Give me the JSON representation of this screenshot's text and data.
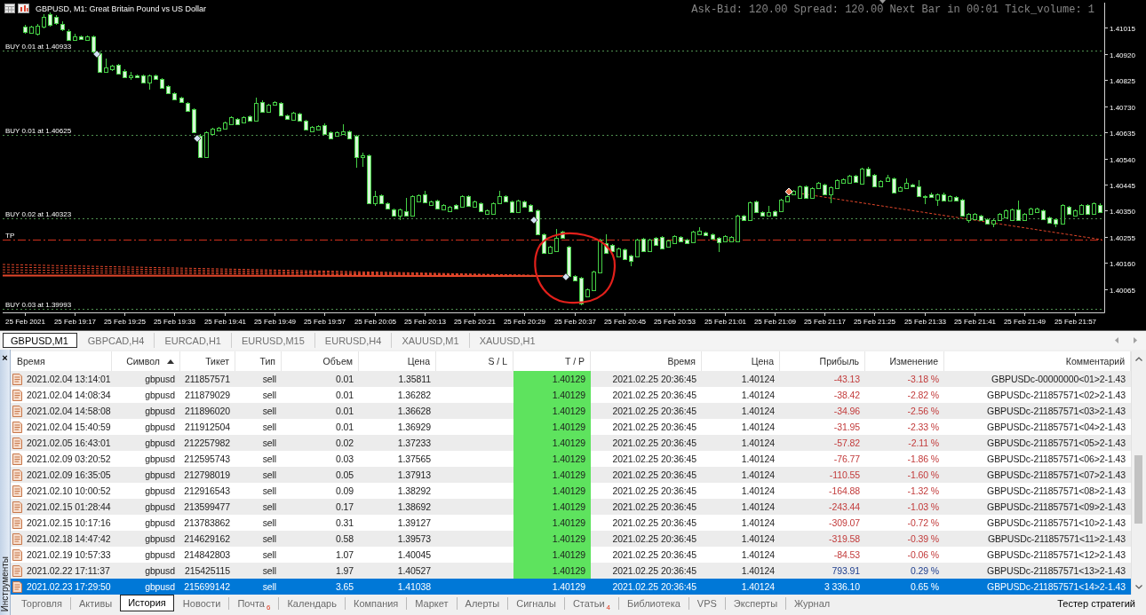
{
  "chart_window": {
    "title": "GBPUSD, M1: Great Britain Pound vs US Dollar",
    "info": "Ask-Bid: 120.00 Spread: 120.00 Next Bar in 00:01 Tick_volume: 1",
    "chart_data": [
      {
        "type": "candlestick",
        "ylim": [
          1.3998,
          1.41107
        ],
        "xlim": [
          "2021-02-25T19:05:30",
          "2021-02-25T22:01:45"
        ],
        "yticks": [
          1.40065,
          {
            "value": 1.4016,
            "label": "1.40160"
          },
          1.40255,
          {
            "value": 1.4035,
            "label": "1.40350"
          },
          1.40445,
          {
            "value": 1.4054,
            "label": "1.40540"
          },
          1.40635,
          {
            "value": 1.4073,
            "label": "1.40730"
          },
          1.40825,
          {
            "value": 1.4092,
            "label": "1.40920"
          },
          1.41015
        ],
        "xticks": [
          {
            "value": "2021-02-25T19:09",
            "label": "25 Feb 2021"
          },
          {
            "value": "2021-02-25T19:17",
            "label": "25 Feb 19:17"
          },
          {
            "value": "2021-02-25T19:25",
            "label": "25 Feb 19:25"
          },
          {
            "value": "2021-02-25T19:33",
            "label": "25 Feb 19:33"
          },
          {
            "value": "2021-02-25T19:41",
            "label": "25 Feb 19:41"
          },
          {
            "value": "2021-02-25T19:49",
            "label": "25 Feb 19:49"
          },
          {
            "value": "2021-02-25T19:57",
            "label": "25 Feb 19:57"
          },
          {
            "value": "2021-02-25T20:05",
            "label": "25 Feb 20:05"
          },
          {
            "value": "2021-02-25T20:13",
            "label": "25 Feb 20:13"
          },
          {
            "value": "2021-02-25T20:21",
            "label": "25 Feb 20:21"
          },
          {
            "value": "2021-02-25T20:29",
            "label": "25 Feb 20:29"
          },
          {
            "value": "2021-02-25T20:37",
            "label": "25 Feb 20:37"
          },
          {
            "value": "2021-02-25T20:45",
            "label": "25 Feb 20:45"
          },
          {
            "value": "2021-02-25T20:53",
            "label": "25 Feb 20:53"
          },
          {
            "value": "2021-02-25T21:01",
            "label": "25 Feb 21:01"
          },
          {
            "value": "2021-02-25T21:09",
            "label": "25 Feb 21:09"
          },
          {
            "value": "2021-02-25T21:17",
            "label": "25 Feb 21:17"
          },
          {
            "value": "2021-02-25T21:25",
            "label": "25 Feb 21:25"
          },
          {
            "value": "2021-02-25T21:33",
            "label": "25 Feb 21:33"
          },
          {
            "value": "2021-02-25T21:41",
            "label": "25 Feb 21:41"
          },
          {
            "value": "2021-02-25T21:49",
            "label": "25 Feb 21:49"
          },
          {
            "value": "2021-02-25T21:57",
            "label": "25 Feb 21:57"
          }
        ],
        "ref_lines": [
          {
            "axis": "y",
            "value": 1.40933,
            "label": "BUY 0.01 at 1.40933",
            "color": "#4f8f4f",
            "line_style": "dotted"
          },
          {
            "axis": "y",
            "value": 1.40625,
            "label": "BUY 0.01 at 1.40625",
            "color": "#4f8f4f",
            "line_style": "dotted"
          },
          {
            "axis": "y",
            "value": 1.40323,
            "label": "BUY 0.02 at 1.40323",
            "color": "#4f8f4f",
            "line_style": "dotted"
          },
          {
            "axis": "y",
            "value": 1.40245,
            "label": "TP",
            "color": "#d0301c",
            "line_style": "dashdot"
          },
          {
            "axis": "y",
            "value": 1.39993,
            "label": "BUY 0.03 at 1.39993",
            "color": "#4f8f4f",
            "line_style": "dotted"
          }
        ],
        "x": [
          "2021-02-25T19:09",
          "2021-02-25T19:10",
          "2021-02-25T19:11",
          "2021-02-25T19:12",
          "2021-02-25T19:13",
          "2021-02-25T19:14",
          "2021-02-25T19:15",
          "2021-02-25T19:16",
          "2021-02-25T19:17",
          "2021-02-25T19:18",
          "2021-02-25T19:19",
          "2021-02-25T19:20",
          "2021-02-25T19:21",
          "2021-02-25T19:22",
          "2021-02-25T19:23",
          "2021-02-25T19:24",
          "2021-02-25T19:25",
          "2021-02-25T19:26",
          "2021-02-25T19:27",
          "2021-02-25T19:28",
          "2021-02-25T19:29",
          "2021-02-25T19:30",
          "2021-02-25T19:31",
          "2021-02-25T19:32",
          "2021-02-25T19:33",
          "2021-02-25T19:34",
          "2021-02-25T19:35",
          "2021-02-25T19:36",
          "2021-02-25T19:37",
          "2021-02-25T19:38",
          "2021-02-25T19:39",
          "2021-02-25T19:40",
          "2021-02-25T19:41",
          "2021-02-25T19:42",
          "2021-02-25T19:43",
          "2021-02-25T19:44",
          "2021-02-25T19:45",
          "2021-02-25T19:46",
          "2021-02-25T19:47",
          "2021-02-25T19:48",
          "2021-02-25T19:49",
          "2021-02-25T19:50",
          "2021-02-25T19:51",
          "2021-02-25T19:52",
          "2021-02-25T19:53",
          "2021-02-25T19:54",
          "2021-02-25T19:55",
          "2021-02-25T19:56",
          "2021-02-25T19:57",
          "2021-02-25T19:58",
          "2021-02-25T19:59",
          "2021-02-25T20:00",
          "2021-02-25T20:01",
          "2021-02-25T20:02",
          "2021-02-25T20:03",
          "2021-02-25T20:04",
          "2021-02-25T20:05",
          "2021-02-25T20:06",
          "2021-02-25T20:07",
          "2021-02-25T20:08",
          "2021-02-25T20:09",
          "2021-02-25T20:10",
          "2021-02-25T20:11",
          "2021-02-25T20:12",
          "2021-02-25T20:13",
          "2021-02-25T20:14",
          "2021-02-25T20:15",
          "2021-02-25T20:16",
          "2021-02-25T20:17",
          "2021-02-25T20:18",
          "2021-02-25T20:19",
          "2021-02-25T20:20",
          "2021-02-25T20:21",
          "2021-02-25T20:22",
          "2021-02-25T20:23",
          "2021-02-25T20:24",
          "2021-02-25T20:25",
          "2021-02-25T20:26",
          "2021-02-25T20:27",
          "2021-02-25T20:28",
          "2021-02-25T20:29",
          "2021-02-25T20:30",
          "2021-02-25T20:31",
          "2021-02-25T20:32",
          "2021-02-25T20:33",
          "2021-02-25T20:34",
          "2021-02-25T20:35",
          "2021-02-25T20:36",
          "2021-02-25T20:37",
          "2021-02-25T20:38",
          "2021-02-25T20:39",
          "2021-02-25T20:40",
          "2021-02-25T20:41",
          "2021-02-25T20:42",
          "2021-02-25T20:43",
          "2021-02-25T20:44",
          "2021-02-25T20:45",
          "2021-02-25T20:46",
          "2021-02-25T20:47",
          "2021-02-25T20:48",
          "2021-02-25T20:49",
          "2021-02-25T20:50",
          "2021-02-25T20:51",
          "2021-02-25T20:52",
          "2021-02-25T20:53",
          "2021-02-25T20:54",
          "2021-02-25T20:55",
          "2021-02-25T20:56",
          "2021-02-25T20:57",
          "2021-02-25T20:58",
          "2021-02-25T20:59",
          "2021-02-25T21:00",
          "2021-02-25T21:01",
          "2021-02-25T21:02",
          "2021-02-25T21:03",
          "2021-02-25T21:04",
          "2021-02-25T21:05",
          "2021-02-25T21:06",
          "2021-02-25T21:07",
          "2021-02-25T21:08",
          "2021-02-25T21:09",
          "2021-02-25T21:10",
          "2021-02-25T21:11",
          "2021-02-25T21:12",
          "2021-02-25T21:13",
          "2021-02-25T21:14",
          "2021-02-25T21:15",
          "2021-02-25T21:16",
          "2021-02-25T21:17",
          "2021-02-25T21:18",
          "2021-02-25T21:19",
          "2021-02-25T21:20",
          "2021-02-25T21:21",
          "2021-02-25T21:22",
          "2021-02-25T21:23",
          "2021-02-25T21:24",
          "2021-02-25T21:25",
          "2021-02-25T21:26",
          "2021-02-25T21:27",
          "2021-02-25T21:28",
          "2021-02-25T21:29",
          "2021-02-25T21:30",
          "2021-02-25T21:31",
          "2021-02-25T21:32",
          "2021-02-25T21:33",
          "2021-02-25T21:34",
          "2021-02-25T21:35",
          "2021-02-25T21:36",
          "2021-02-25T21:37",
          "2021-02-25T21:38",
          "2021-02-25T21:39",
          "2021-02-25T21:40",
          "2021-02-25T21:41",
          "2021-02-25T21:42",
          "2021-02-25T21:43",
          "2021-02-25T21:44",
          "2021-02-25T21:45",
          "2021-02-25T21:46",
          "2021-02-25T21:47",
          "2021-02-25T21:48",
          "2021-02-25T21:49",
          "2021-02-25T21:50",
          "2021-02-25T21:51",
          "2021-02-25T21:52",
          "2021-02-25T21:53",
          "2021-02-25T21:54",
          "2021-02-25T21:55",
          "2021-02-25T21:56",
          "2021-02-25T21:57",
          "2021-02-25T21:58",
          "2021-02-25T21:59",
          "2021-02-25T22:00",
          "2021-02-25T22:01"
        ],
        "ohlc": [
          [
            1.4102,
            1.41027,
            1.40994,
            1.41001
          ],
          [
            1.40997,
            1.41023,
            1.40994,
            1.4102
          ],
          [
            1.40994,
            1.4103,
            1.40988,
            1.41023
          ],
          [
            1.4102,
            1.41065,
            1.41014,
            1.41056
          ],
          [
            1.41065,
            1.41072,
            1.4102,
            1.41027
          ],
          [
            1.41056,
            1.41062,
            1.41027,
            1.41033
          ],
          [
            1.4103,
            1.41039,
            1.41004,
            1.4101
          ],
          [
            1.41004,
            1.4101,
            1.40968,
            1.40972
          ],
          [
            1.40972,
            1.40994,
            1.40968,
            1.40985
          ],
          [
            1.40985,
            1.40988,
            1.40972,
            1.40975
          ],
          [
            1.40972,
            1.40988,
            1.40968,
            1.40985
          ],
          [
            1.40985,
            1.40988,
            1.40923,
            1.4093
          ],
          [
            1.40923,
            1.4093,
            1.40852,
            1.40855
          ],
          [
            1.40855,
            1.40904,
            1.40852,
            1.40872
          ],
          [
            1.40865,
            1.40881,
            1.40859,
            1.40878
          ],
          [
            1.40881,
            1.40884,
            1.40846,
            1.40849
          ],
          [
            1.40859,
            1.40865,
            1.40833,
            1.40836
          ],
          [
            1.40836,
            1.40855,
            1.40826,
            1.40842
          ],
          [
            1.40842,
            1.40846,
            1.40833,
            1.40836
          ],
          [
            1.40842,
            1.40846,
            1.40814,
            1.40817
          ],
          [
            1.40817,
            1.40846,
            1.40791,
            1.40842
          ],
          [
            1.40842,
            1.40846,
            1.40826,
            1.4083
          ],
          [
            1.4083,
            1.40833,
            1.40794,
            1.40797
          ],
          [
            1.40804,
            1.40807,
            1.40775,
            1.40778
          ],
          [
            1.40778,
            1.40781,
            1.40752,
            1.40755
          ],
          [
            1.40762,
            1.40765,
            1.40742,
            1.40746
          ],
          [
            1.40742,
            1.40746,
            1.4071,
            1.40713
          ],
          [
            1.4072,
            1.40723,
            1.40632,
            1.40636
          ],
          [
            1.40623,
            1.40629,
            1.40542,
            1.40545
          ],
          [
            1.40545,
            1.40639,
            1.40542,
            1.40636
          ],
          [
            1.40629,
            1.40652,
            1.40626,
            1.40649
          ],
          [
            1.40642,
            1.40655,
            1.40639,
            1.40652
          ],
          [
            1.40649,
            1.40674,
            1.40645,
            1.40671
          ],
          [
            1.40665,
            1.40694,
            1.40662,
            1.40691
          ],
          [
            1.40684,
            1.40688,
            1.40662,
            1.40665
          ],
          [
            1.40671,
            1.40694,
            1.40668,
            1.40691
          ],
          [
            1.40694,
            1.40697,
            1.40674,
            1.40678
          ],
          [
            1.40678,
            1.40762,
            1.40674,
            1.40742
          ],
          [
            1.40746,
            1.40752,
            1.40707,
            1.4071
          ],
          [
            1.4071,
            1.40739,
            1.40707,
            1.40736
          ],
          [
            1.40736,
            1.40749,
            1.40733,
            1.40746
          ],
          [
            1.40742,
            1.40746,
            1.40694,
            1.40697
          ],
          [
            1.40697,
            1.407,
            1.40681,
            1.40684
          ],
          [
            1.40681,
            1.4071,
            1.40678,
            1.40707
          ],
          [
            1.40704,
            1.40707,
            1.40674,
            1.40678
          ],
          [
            1.40678,
            1.40681,
            1.40642,
            1.40645
          ],
          [
            1.40639,
            1.40658,
            1.40636,
            1.40655
          ],
          [
            1.40645,
            1.40662,
            1.40642,
            1.40658
          ],
          [
            1.40662,
            1.40668,
            1.40626,
            1.40629
          ],
          [
            1.40636,
            1.40639,
            1.4061,
            1.40613
          ],
          [
            1.40623,
            1.40639,
            1.4062,
            1.40636
          ],
          [
            1.40629,
            1.40665,
            1.40626,
            1.40639
          ],
          [
            1.40639,
            1.40642,
            1.4061,
            1.40613
          ],
          [
            1.40623,
            1.40626,
            1.40507,
            1.40545
          ],
          [
            1.40545,
            1.40561,
            1.4051,
            1.40552
          ],
          [
            1.40552,
            1.40555,
            1.40374,
            1.40377
          ],
          [
            1.40377,
            1.40423,
            1.40368,
            1.40404
          ],
          [
            1.40407,
            1.4041,
            1.40374,
            1.40377
          ],
          [
            1.40377,
            1.40381,
            1.40354,
            1.40358
          ],
          [
            1.40354,
            1.40358,
            1.40329,
            1.40332
          ],
          [
            1.40332,
            1.40358,
            1.40316,
            1.40354
          ],
          [
            1.40348,
            1.40397,
            1.40329,
            1.40332
          ],
          [
            1.40332,
            1.40407,
            1.40329,
            1.40404
          ],
          [
            1.40384,
            1.4041,
            1.40381,
            1.40407
          ],
          [
            1.4041,
            1.40423,
            1.40377,
            1.40381
          ],
          [
            1.40371,
            1.40387,
            1.40368,
            1.40384
          ],
          [
            1.40387,
            1.4039,
            1.40354,
            1.40358
          ],
          [
            1.40354,
            1.40374,
            1.40351,
            1.40371
          ],
          [
            1.40348,
            1.40368,
            1.40345,
            1.40364
          ],
          [
            1.40371,
            1.40374,
            1.40354,
            1.40358
          ],
          [
            1.40364,
            1.40407,
            1.40361,
            1.40404
          ],
          [
            1.40404,
            1.40407,
            1.40364,
            1.40368
          ],
          [
            1.40364,
            1.40387,
            1.40361,
            1.40384
          ],
          [
            1.40377,
            1.40381,
            1.40345,
            1.40348
          ],
          [
            1.40339,
            1.40354,
            1.40335,
            1.40351
          ],
          [
            1.40339,
            1.40381,
            1.40335,
            1.40377
          ],
          [
            1.40377,
            1.40423,
            1.40374,
            1.40404
          ],
          [
            1.40404,
            1.40407,
            1.40381,
            1.40384
          ],
          [
            1.40384,
            1.40387,
            1.40342,
            1.40345
          ],
          [
            1.40345,
            1.4039,
            1.40342,
            1.40387
          ],
          [
            1.40384,
            1.40387,
            1.40361,
            1.40364
          ],
          [
            1.40371,
            1.40374,
            1.40345,
            1.40348
          ],
          [
            1.40351,
            1.40354,
            1.40261,
            1.40264
          ],
          [
            1.40264,
            1.40268,
            1.40193,
            1.40197
          ],
          [
            1.40197,
            1.40222,
            1.40193,
            1.40219
          ],
          [
            1.40203,
            1.40284,
            1.402,
            1.40251
          ],
          [
            1.40274,
            1.40277,
            1.40248,
            1.40251
          ],
          [
            1.40219,
            1.40222,
            1.40109,
            1.40112
          ],
          [
            1.40112,
            1.40115,
            1.40093,
            1.40096
          ],
          [
            1.40106,
            1.40109,
            1.40006,
            1.40012
          ],
          [
            1.40038,
            1.40067,
            1.40035,
            1.40064
          ],
          [
            1.40061,
            1.40132,
            1.40058,
            1.40129
          ],
          [
            1.40125,
            1.40248,
            1.40122,
            1.40245
          ],
          [
            1.40232,
            1.40264,
            1.40193,
            1.40197
          ],
          [
            1.40226,
            1.40229,
            1.402,
            1.40203
          ],
          [
            1.40184,
            1.40216,
            1.4018,
            1.40213
          ],
          [
            1.40209,
            1.40213,
            1.4017,
            1.40174
          ],
          [
            1.40187,
            1.4019,
            1.40148,
            1.40167
          ],
          [
            1.40184,
            1.40248,
            1.4018,
            1.40245
          ],
          [
            1.40248,
            1.40251,
            1.402,
            1.40203
          ],
          [
            1.40203,
            1.40248,
            1.402,
            1.40245
          ],
          [
            1.40251,
            1.40255,
            1.40222,
            1.40226
          ],
          [
            1.40255,
            1.40258,
            1.40209,
            1.40213
          ],
          [
            1.40219,
            1.40245,
            1.40216,
            1.40242
          ],
          [
            1.40232,
            1.40261,
            1.40229,
            1.40258
          ],
          [
            1.40255,
            1.40258,
            1.40235,
            1.40238
          ],
          [
            1.40245,
            1.40248,
            1.40229,
            1.40232
          ],
          [
            1.40235,
            1.40277,
            1.40232,
            1.40274
          ],
          [
            1.40264,
            1.4029,
            1.40261,
            1.40277
          ],
          [
            1.40271,
            1.40274,
            1.40258,
            1.40261
          ],
          [
            1.40264,
            1.40268,
            1.40245,
            1.40248
          ],
          [
            1.40251,
            1.40255,
            1.402,
            1.40235
          ],
          [
            1.40238,
            1.40261,
            1.40235,
            1.40258
          ],
          [
            1.40238,
            1.40258,
            1.40235,
            1.40255
          ],
          [
            1.40238,
            1.40335,
            1.40235,
            1.40332
          ],
          [
            1.40332,
            1.40335,
            1.40313,
            1.40316
          ],
          [
            1.40316,
            1.40384,
            1.40313,
            1.40381
          ],
          [
            1.40384,
            1.40387,
            1.40342,
            1.40345
          ],
          [
            1.40345,
            1.40348,
            1.40329,
            1.40332
          ],
          [
            1.40332,
            1.40368,
            1.40329,
            1.40345
          ],
          [
            1.40348,
            1.40351,
            1.40329,
            1.40332
          ],
          [
            1.40348,
            1.40394,
            1.40345,
            1.4039
          ],
          [
            1.40384,
            1.40407,
            1.40381,
            1.40404
          ],
          [
            1.4041,
            1.40426,
            1.40407,
            1.40423
          ],
          [
            1.40397,
            1.40442,
            1.40394,
            1.40439
          ],
          [
            1.40439,
            1.40442,
            1.40394,
            1.40397
          ],
          [
            1.40397,
            1.40436,
            1.40394,
            1.40432
          ],
          [
            1.40432,
            1.40455,
            1.40429,
            1.40452
          ],
          [
            1.40445,
            1.40449,
            1.40407,
            1.4041
          ],
          [
            1.4041,
            1.40439,
            1.40377,
            1.40436
          ],
          [
            1.40432,
            1.40465,
            1.40429,
            1.40461
          ],
          [
            1.40452,
            1.40468,
            1.40449,
            1.40465
          ],
          [
            1.40452,
            1.40481,
            1.40449,
            1.40477
          ],
          [
            1.40477,
            1.40481,
            1.40452,
            1.40455
          ],
          [
            1.40449,
            1.40507,
            1.40445,
            1.40504
          ],
          [
            1.40504,
            1.4051,
            1.40474,
            1.40477
          ],
          [
            1.40481,
            1.40484,
            1.40436,
            1.40439
          ],
          [
            1.40439,
            1.40461,
            1.40436,
            1.40458
          ],
          [
            1.40458,
            1.40481,
            1.40455,
            1.40471
          ],
          [
            1.40468,
            1.40471,
            1.40413,
            1.40416
          ],
          [
            1.40423,
            1.40439,
            1.4042,
            1.40436
          ],
          [
            1.40432,
            1.40468,
            1.40429,
            1.40452
          ],
          [
            1.40445,
            1.40449,
            1.40436,
            1.40439
          ],
          [
            1.40439,
            1.40461,
            1.404,
            1.40404
          ],
          [
            1.40404,
            1.40407,
            1.40374,
            1.404
          ],
          [
            1.4041,
            1.40416,
            1.40397,
            1.404
          ],
          [
            1.4039,
            1.40413,
            1.40368,
            1.4041
          ],
          [
            1.4041,
            1.40416,
            1.40384,
            1.40387
          ],
          [
            1.40387,
            1.40407,
            1.40384,
            1.40404
          ],
          [
            1.404,
            1.40404,
            1.40384,
            1.40387
          ],
          [
            1.4039,
            1.40394,
            1.40329,
            1.40332
          ],
          [
            1.40316,
            1.40342,
            1.40306,
            1.40339
          ],
          [
            1.40319,
            1.40342,
            1.40316,
            1.40339
          ],
          [
            1.40332,
            1.40335,
            1.40313,
            1.40316
          ],
          [
            1.40319,
            1.40322,
            1.403,
            1.40303
          ],
          [
            1.40303,
            1.40319,
            1.4029,
            1.40316
          ],
          [
            1.40316,
            1.40342,
            1.40313,
            1.40339
          ],
          [
            1.40326,
            1.40354,
            1.40322,
            1.40351
          ],
          [
            1.40316,
            1.40358,
            1.40313,
            1.40354
          ],
          [
            1.40354,
            1.40387,
            1.40313,
            1.40316
          ],
          [
            1.40316,
            1.40342,
            1.40313,
            1.40339
          ],
          [
            1.40339,
            1.40361,
            1.40335,
            1.40358
          ],
          [
            1.40345,
            1.40361,
            1.40342,
            1.40358
          ],
          [
            1.40351,
            1.40354,
            1.40316,
            1.40319
          ],
          [
            1.40326,
            1.40329,
            1.40303,
            1.40306
          ],
          [
            1.40319,
            1.40322,
            1.4029,
            1.40303
          ],
          [
            1.40303,
            1.40374,
            1.403,
            1.40371
          ],
          [
            1.40364,
            1.40368,
            1.40335,
            1.40339
          ],
          [
            1.40332,
            1.40354,
            1.40329,
            1.40351
          ],
          [
            1.40339,
            1.40374,
            1.40335,
            1.40371
          ],
          [
            1.40371,
            1.40374,
            1.40335,
            1.40339
          ],
          [
            1.40339,
            1.40381,
            1.40335,
            1.40377
          ],
          [
            1.40371,
            1.40377,
            1.40342,
            1.40345
          ]
        ]
      }
    ]
  },
  "chart_tabs": [
    {
      "label": "GBPUSD,M1",
      "selected": true
    },
    {
      "label": "GBPCAD,H4",
      "selected": false
    },
    {
      "label": "EURCAD,H1",
      "selected": false
    },
    {
      "label": "EURUSD,M15",
      "selected": false
    },
    {
      "label": "EURUSD,H4",
      "selected": false
    },
    {
      "label": "XAUUSD,M1",
      "selected": false
    },
    {
      "label": "XAUUSD,H1",
      "selected": false
    }
  ],
  "toolbox": {
    "close": "×",
    "side_label": "Инструменты",
    "table": {
      "columns": [
        {
          "label": "Время",
          "sorted": false
        },
        {
          "label": "Символ",
          "sorted": true
        },
        {
          "label": "Тикет",
          "sorted": false
        },
        {
          "label": "Тип",
          "sorted": false
        },
        {
          "label": "Объем",
          "sorted": false
        },
        {
          "label": "Цена",
          "sorted": false
        },
        {
          "label": "S / L",
          "sorted": false
        },
        {
          "label": "T / P",
          "sorted": false
        },
        {
          "label": "Время",
          "sorted": false
        },
        {
          "label": "Цена",
          "sorted": false
        },
        {
          "label": "Прибыль",
          "sorted": false
        },
        {
          "label": "Изменение",
          "sorted": false
        },
        {
          "label": "Комментарий",
          "sorted": false
        }
      ],
      "rows": [
        {
          "open_time": "2021.02.04 13:14:01",
          "symbol": "gbpusd",
          "ticket": "211857571",
          "type": "sell",
          "volume": "0.01",
          "open_price": "1.35811",
          "tp": "1.40129",
          "close_time": "2021.02.25 20:36:45",
          "close_price": "1.40124",
          "profit": "-43.13",
          "change": "-3.18 %",
          "comment": "GBPUSDc-00000000<01>2-1.43",
          "loss": true,
          "selected": false
        },
        {
          "open_time": "2021.02.04 14:08:34",
          "symbol": "gbpusd",
          "ticket": "211879029",
          "type": "sell",
          "volume": "0.01",
          "open_price": "1.36282",
          "tp": "1.40129",
          "close_time": "2021.02.25 20:36:45",
          "close_price": "1.40124",
          "profit": "-38.42",
          "change": "-2.82 %",
          "comment": "GBPUSDc-211857571<02>2-1.43",
          "loss": true,
          "selected": false
        },
        {
          "open_time": "2021.02.04 14:58:08",
          "symbol": "gbpusd",
          "ticket": "211896020",
          "type": "sell",
          "volume": "0.01",
          "open_price": "1.36628",
          "tp": "1.40129",
          "close_time": "2021.02.25 20:36:45",
          "close_price": "1.40124",
          "profit": "-34.96",
          "change": "-2.56 %",
          "comment": "GBPUSDc-211857571<03>2-1.43",
          "loss": true,
          "selected": false
        },
        {
          "open_time": "2021.02.04 15:40:59",
          "symbol": "gbpusd",
          "ticket": "211912504",
          "type": "sell",
          "volume": "0.01",
          "open_price": "1.36929",
          "tp": "1.40129",
          "close_time": "2021.02.25 20:36:45",
          "close_price": "1.40124",
          "profit": "-31.95",
          "change": "-2.33 %",
          "comment": "GBPUSDc-211857571<04>2-1.43",
          "loss": true,
          "selected": false
        },
        {
          "open_time": "2021.02.05 16:43:01",
          "symbol": "gbpusd",
          "ticket": "212257982",
          "type": "sell",
          "volume": "0.02",
          "open_price": "1.37233",
          "tp": "1.40129",
          "close_time": "2021.02.25 20:36:45",
          "close_price": "1.40124",
          "profit": "-57.82",
          "change": "-2.11 %",
          "comment": "GBPUSDc-211857571<05>2-1.43",
          "loss": true,
          "selected": false
        },
        {
          "open_time": "2021.02.09 03:20:52",
          "symbol": "gbpusd",
          "ticket": "212595743",
          "type": "sell",
          "volume": "0.03",
          "open_price": "1.37565",
          "tp": "1.40129",
          "close_time": "2021.02.25 20:36:45",
          "close_price": "1.40124",
          "profit": "-76.77",
          "change": "-1.86 %",
          "comment": "GBPUSDc-211857571<06>2-1.43",
          "loss": true,
          "selected": false
        },
        {
          "open_time": "2021.02.09 16:35:05",
          "symbol": "gbpusd",
          "ticket": "212798019",
          "type": "sell",
          "volume": "0.05",
          "open_price": "1.37913",
          "tp": "1.40129",
          "close_time": "2021.02.25 20:36:45",
          "close_price": "1.40124",
          "profit": "-110.55",
          "change": "-1.60 %",
          "comment": "GBPUSDc-211857571<07>2-1.43",
          "loss": true,
          "selected": false
        },
        {
          "open_time": "2021.02.10 10:00:52",
          "symbol": "gbpusd",
          "ticket": "212916543",
          "type": "sell",
          "volume": "0.09",
          "open_price": "1.38292",
          "tp": "1.40129",
          "close_time": "2021.02.25 20:36:45",
          "close_price": "1.40124",
          "profit": "-164.88",
          "change": "-1.32 %",
          "comment": "GBPUSDc-211857571<08>2-1.43",
          "loss": true,
          "selected": false
        },
        {
          "open_time": "2021.02.15 01:28:44",
          "symbol": "gbpusd",
          "ticket": "213599477",
          "type": "sell",
          "volume": "0.17",
          "open_price": "1.38692",
          "tp": "1.40129",
          "close_time": "2021.02.25 20:36:45",
          "close_price": "1.40124",
          "profit": "-243.44",
          "change": "-1.03 %",
          "comment": "GBPUSDc-211857571<09>2-1.43",
          "loss": true,
          "selected": false
        },
        {
          "open_time": "2021.02.15 10:17:16",
          "symbol": "gbpusd",
          "ticket": "213783862",
          "type": "sell",
          "volume": "0.31",
          "open_price": "1.39127",
          "tp": "1.40129",
          "close_time": "2021.02.25 20:36:45",
          "close_price": "1.40124",
          "profit": "-309.07",
          "change": "-0.72 %",
          "comment": "GBPUSDc-211857571<10>2-1.43",
          "loss": true,
          "selected": false
        },
        {
          "open_time": "2021.02.18 14:47:42",
          "symbol": "gbpusd",
          "ticket": "214629162",
          "type": "sell",
          "volume": "0.58",
          "open_price": "1.39573",
          "tp": "1.40129",
          "close_time": "2021.02.25 20:36:45",
          "close_price": "1.40124",
          "profit": "-319.58",
          "change": "-0.39 %",
          "comment": "GBPUSDc-211857571<11>2-1.43",
          "loss": true,
          "selected": false
        },
        {
          "open_time": "2021.02.19 10:57:33",
          "symbol": "gbpusd",
          "ticket": "214842803",
          "type": "sell",
          "volume": "1.07",
          "open_price": "1.40045",
          "tp": "1.40129",
          "close_time": "2021.02.25 20:36:45",
          "close_price": "1.40124",
          "profit": "-84.53",
          "change": "-0.06 %",
          "comment": "GBPUSDc-211857571<12>2-1.43",
          "loss": true,
          "selected": false
        },
        {
          "open_time": "2021.02.22 17:11:37",
          "symbol": "gbpusd",
          "ticket": "215425115",
          "type": "sell",
          "volume": "1.97",
          "open_price": "1.40527",
          "tp": "1.40129",
          "close_time": "2021.02.25 20:36:45",
          "close_price": "1.40124",
          "profit": "793.91",
          "change": "0.29 %",
          "comment": "GBPUSDc-211857571<13>2-1.43",
          "loss": false,
          "selected": false
        },
        {
          "open_time": "2021.02.23 17:29:50",
          "symbol": "gbpusd",
          "ticket": "215699142",
          "type": "sell",
          "volume": "3.65",
          "open_price": "1.41038",
          "tp": "1.40129",
          "close_time": "2021.02.25 20:36:45",
          "close_price": "1.40124",
          "profit": "3 336.10",
          "change": "0.65 %",
          "comment": "GBPUSDc-211857571<14>2-1.43",
          "loss": false,
          "selected": true
        }
      ]
    },
    "tabs": [
      {
        "label": "Торговля",
        "selected": false
      },
      {
        "label": "Активы",
        "selected": false
      },
      {
        "label": "История",
        "selected": true
      },
      {
        "label": "Новости",
        "selected": false
      },
      {
        "label": "Почта",
        "badge": "6",
        "selected": false
      },
      {
        "label": "Календарь",
        "selected": false
      },
      {
        "label": "Компания",
        "selected": false
      },
      {
        "label": "Маркет",
        "selected": false
      },
      {
        "label": "Алерты",
        "selected": false
      },
      {
        "label": "Сигналы",
        "selected": false
      },
      {
        "label": "Статьи",
        "badge": "4",
        "selected": false
      },
      {
        "label": "Библиотека",
        "selected": false
      },
      {
        "label": "VPS",
        "selected": false
      },
      {
        "label": "Эксперты",
        "selected": false
      },
      {
        "label": "Журнал",
        "selected": false
      }
    ],
    "strategy_tester": "Тестер стратегий"
  }
}
